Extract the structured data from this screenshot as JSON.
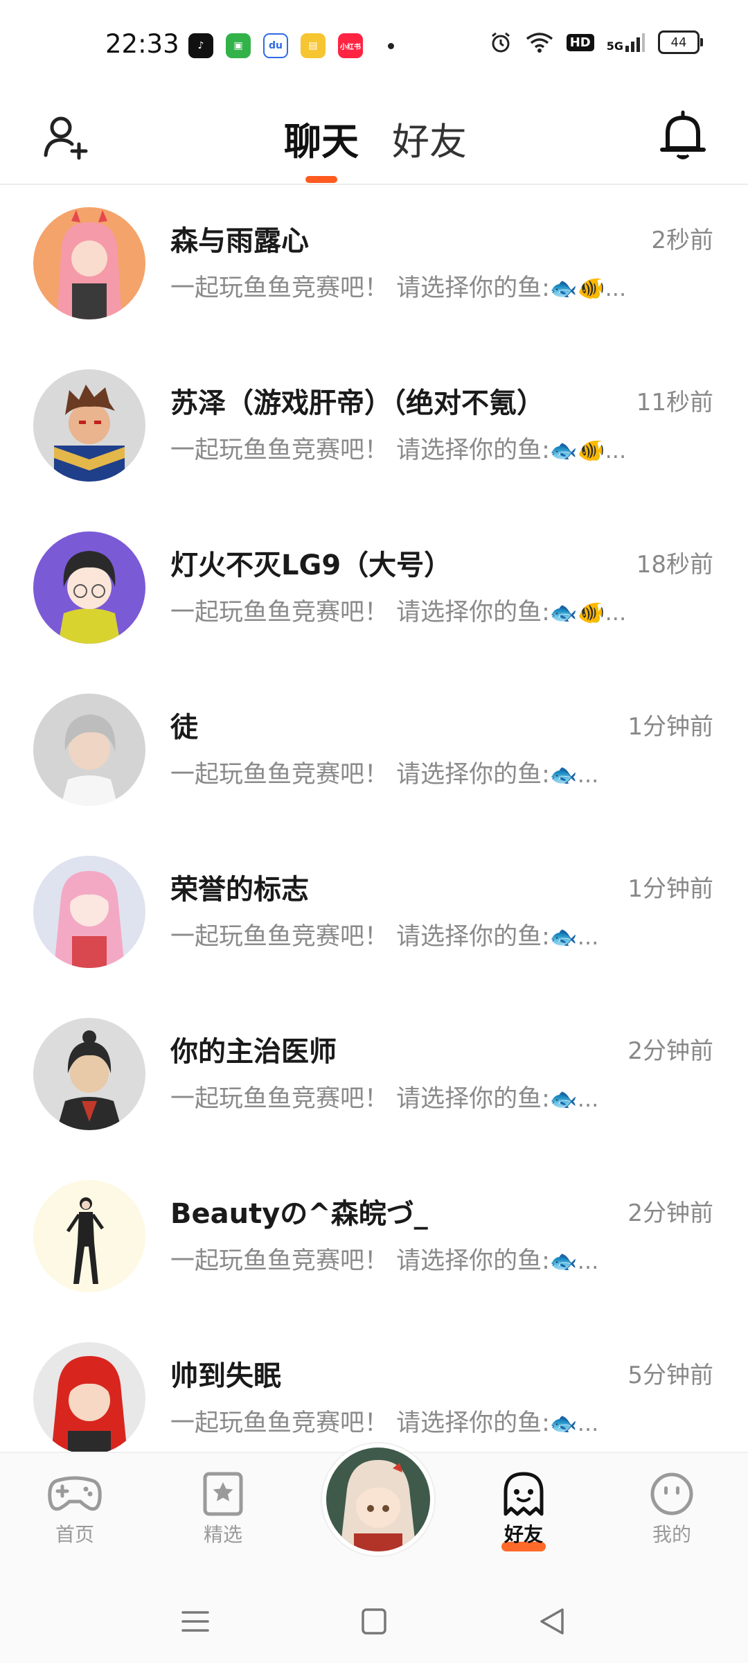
{
  "status_bar": {
    "time": "22:33",
    "apps": [
      {
        "icon": "tiktok-icon",
        "color": "#111111",
        "text": "♪"
      },
      {
        "icon": "wechat-mini-icon",
        "color": "#34b24a",
        "text": "▣"
      },
      {
        "icon": "baidu-icon",
        "color": "#ffffff",
        "text": "du"
      },
      {
        "icon": "notes-icon",
        "color": "#f7c531",
        "text": "▤"
      },
      {
        "icon": "xiaohongshu-icon",
        "color": "#ff2442",
        "text": "小红书"
      }
    ],
    "hd": "HD",
    "network": "5G",
    "battery": "44"
  },
  "header": {
    "tabs": [
      {
        "label": "聊天",
        "active": true
      },
      {
        "label": "好友",
        "active": false
      }
    ],
    "accent_color": "#ff5a1f"
  },
  "chats": [
    {
      "name": "森与雨露心",
      "time": "2秒前",
      "message": "一起玩鱼鱼竞赛吧！ 请选择你的鱼:",
      "fish": "🐟🐠...",
      "avatar_bg": "#f4a36b",
      "avatar_hair": "#f59aa8"
    },
    {
      "name": "苏泽（游戏肝帝）（绝对不氪）",
      "time": "11秒前",
      "message": "一起玩鱼鱼竞赛吧！ 请选择你的鱼:",
      "fish": "🐟🐠...",
      "avatar_bg": "#d9d9d9",
      "avatar_hair": "#6a3b22"
    },
    {
      "name": "灯火不灭LG9（大号）",
      "time": "18秒前",
      "message": "一起玩鱼鱼竞赛吧！ 请选择你的鱼:",
      "fish": "🐟🐠...",
      "avatar_bg": "#7b5ad6",
      "avatar_hair": "#2a2a2a"
    },
    {
      "name": "徒",
      "time": "1分钟前",
      "message": "一起玩鱼鱼竞赛吧！ 请选择你的鱼:",
      "fish": "🐟...",
      "avatar_bg": "#d4d4d4",
      "avatar_hair": "#bdbdbd"
    },
    {
      "name": "荣誉的标志",
      "time": "1分钟前",
      "message": "一起玩鱼鱼竞赛吧！ 请选择你的鱼:",
      "fish": "🐟...",
      "avatar_bg": "#dfe2ef",
      "avatar_hair": "#f3a9c4"
    },
    {
      "name": "你的主治医师",
      "time": "2分钟前",
      "message": "一起玩鱼鱼竞赛吧！ 请选择你的鱼:",
      "fish": "🐟...",
      "avatar_bg": "#dcdcdc",
      "avatar_hair": "#2b2b2b"
    },
    {
      "name": "Beautyの^森皖づ_",
      "time": "2分钟前",
      "message": "一起玩鱼鱼竞赛吧！ 请选择你的鱼:",
      "fish": "🐟...",
      "avatar_bg": "#fdf9e4",
      "avatar_hair": "#222222"
    },
    {
      "name": "帅到失眠",
      "time": "5分钟前",
      "message": "一起玩鱼鱼竞赛吧！ 请选择你的鱼:",
      "fish": "🐟...",
      "avatar_bg": "#e8e8e8",
      "avatar_hair": "#d8261f"
    }
  ],
  "bottom_nav": {
    "items": [
      {
        "label": "首页",
        "icon": "gamepad-icon",
        "active": false
      },
      {
        "label": "精选",
        "icon": "star-bookmark-icon",
        "active": false
      },
      {
        "label": "好友",
        "icon": "ghost-friends-icon",
        "active": true
      },
      {
        "label": "我的",
        "icon": "smiley-profile-icon",
        "active": false
      }
    ],
    "active_color": "#ff6a2a"
  },
  "system_nav": {
    "buttons": [
      "menu-icon",
      "home-square-icon",
      "back-triangle-icon"
    ]
  }
}
